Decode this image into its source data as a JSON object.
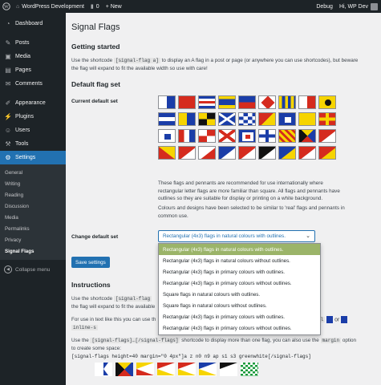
{
  "admin_bar": {
    "site_name": "WordPress Development",
    "comments_count": "0",
    "new_label": "+ New",
    "debug_label": "Debug",
    "greeting": "Hi, WP Dev"
  },
  "sidebar": {
    "items": [
      {
        "label": "Dashboard",
        "icon": "dashboard-icon",
        "glyph": "◔"
      },
      {
        "label": "Posts",
        "icon": "pushpin-icon",
        "glyph": "✎"
      },
      {
        "label": "Media",
        "icon": "media-icon",
        "glyph": "▣"
      },
      {
        "label": "Pages",
        "icon": "pages-icon",
        "glyph": "▤"
      },
      {
        "label": "Comments",
        "icon": "comments-icon",
        "glyph": "✉"
      },
      {
        "label": "Appearance",
        "icon": "paintbrush-icon",
        "glyph": "✐"
      },
      {
        "label": "Plugins",
        "icon": "plugin-icon",
        "glyph": "⚡"
      },
      {
        "label": "Users",
        "icon": "users-icon",
        "glyph": "☺"
      },
      {
        "label": "Tools",
        "icon": "tools-icon",
        "glyph": "⚒"
      },
      {
        "label": "Settings",
        "icon": "settings-icon",
        "glyph": "⚙"
      }
    ],
    "submenu": [
      "General",
      "Writing",
      "Reading",
      "Discussion",
      "Media",
      "Permalinks",
      "Privacy",
      "Signal Flags"
    ],
    "collapse_label": "Collapse menu"
  },
  "page": {
    "title": "Signal Flags",
    "getting_started_heading": "Getting started",
    "getting_started_pre": "Use the shortcode ",
    "getting_started_code": "[signal-flag a]",
    "getting_started_post": " to display an A flag in a post or page (or anywhere you can use shortcodes), but beware",
    "getting_started_line2": "the flag will expand to fit the available width so use with care!",
    "default_heading": "Default flag set",
    "current_default_label": "Current default set",
    "desc1_line1": "These flags and pennants are recommended for use internationally where",
    "desc1_line2": "rectangular letter flags are more familiar than square. All flags and pennants have",
    "desc1_line3": "outlines so they are suitable for display or printing on a white background.",
    "desc2_line1": "Colours and designs have been selected to be similar to 'real' flags and pennants in",
    "desc2_line2": "common use.",
    "change_default_label": "Change default set",
    "select_value": "Rectangular (4x3) flags in natural colours with outlines.",
    "options": [
      "Rectangular (4x3) flags in natural colours with outlines.",
      "Rectangular (4x3) flags in natural colours without outlines.",
      "Rectangular (4x3) flags in primary colours with outlines.",
      "Rectangular (4x3) flags in primary colours without outlines.",
      "Square flags in natural colours with outlines.",
      "Square flags in natural colours without outlines.",
      "Rectangular (4x3) flags in primary colours with outlines.",
      "Rectangular (4x3) flags in primary colours without outlines."
    ],
    "save_button": "Save settings",
    "instructions_heading": "Instructions",
    "instr1_pre": "Use the shortcode ",
    "instr1_code": "[signal-flag",
    "instr1_line2": "the flag will expand to fit the available",
    "instr2_pre": "For use in text like this you can use th",
    "instr2_code_end": "-l",
    "instr2_or": "or",
    "instr2_code2": "inline-s",
    "instr3_pre": "Use the ",
    "instr3_code": "[signal-flags]…[/signal-flags]",
    "instr3_mid": " shortcode to display more than one flag, you can also use the ",
    "instr3_code2": "margin",
    "instr3_post": " option",
    "instr3_line2": "to create some space:",
    "example_code": "[signal-flags height=40 margin=\"0 4px\"]a z n0 n9 ap s1 s3 greenwhite[/signal-flags]"
  },
  "colors": {
    "accent": "#2271b1",
    "selected_option": "#9bb469",
    "sidebar_bg": "#1d2327"
  }
}
